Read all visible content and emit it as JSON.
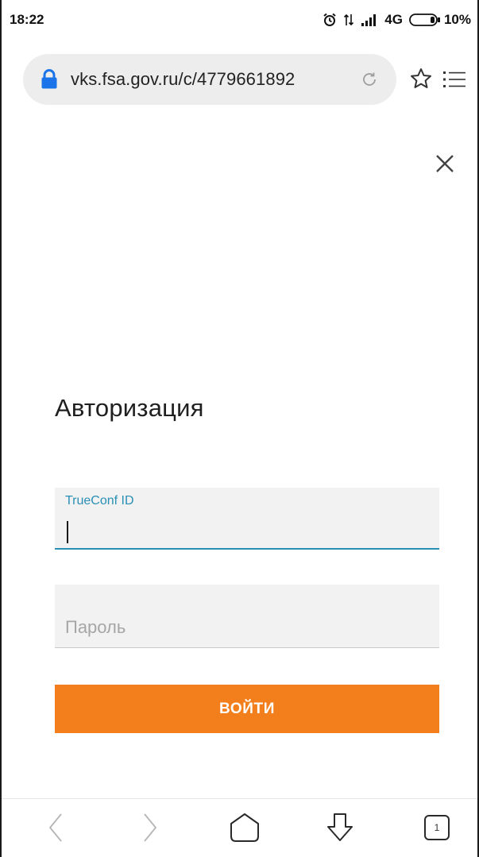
{
  "status_bar": {
    "time": "18:22",
    "network": "4G",
    "battery": "10%",
    "icons": [
      "alarm-icon",
      "data-arrows-icon",
      "signal-icon",
      "battery-icon"
    ]
  },
  "browser": {
    "url": "vks.fsa.gov.ru/c/4779661892",
    "icons": [
      "lock-icon",
      "reload-icon",
      "star-icon",
      "menu-icon"
    ]
  },
  "dialog": {
    "title": "Авторизация",
    "id_field": {
      "label": "TrueConf ID",
      "value": ""
    },
    "password_field": {
      "placeholder": "Пароль",
      "value": ""
    },
    "login_button": "ВОЙТИ"
  },
  "bottom_nav": {
    "tab_count": "1",
    "icons": [
      "back-icon",
      "forward-icon",
      "home-icon",
      "download-icon",
      "tabs-icon"
    ]
  },
  "colors": {
    "accent_orange": "#f37f1c",
    "accent_blue": "#2a8fb5",
    "lock_blue": "#1a73e8"
  }
}
